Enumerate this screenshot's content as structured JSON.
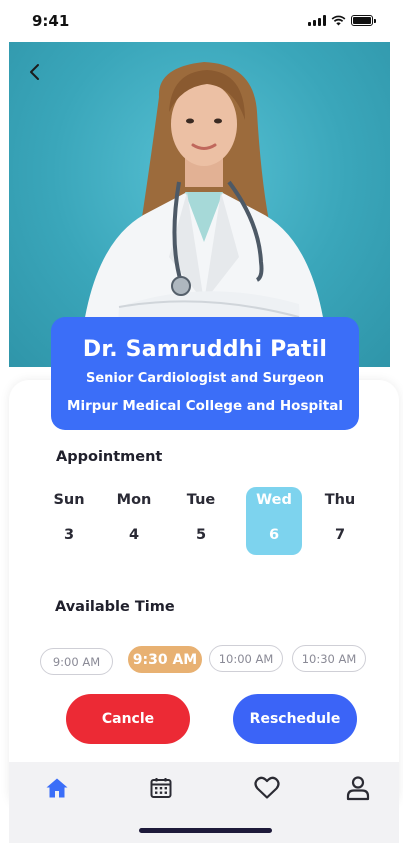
{
  "status_bar": {
    "time": "9:41"
  },
  "doctor": {
    "name": "Dr. Samruddhi Patil",
    "title": "Senior Cardiologist and Surgeon",
    "hospital": "Mirpur Medical College and Hospital"
  },
  "appointment": {
    "label": "Appointment",
    "days": [
      {
        "name": "Sun",
        "number": "3"
      },
      {
        "name": "Mon",
        "number": "4"
      },
      {
        "name": "Tue",
        "number": "5"
      },
      {
        "name": "Wed",
        "number": "6"
      },
      {
        "name": "Thu",
        "number": "7"
      }
    ],
    "selected_day_index": 3
  },
  "available_time": {
    "label": "Available Time",
    "slots": [
      "9:00 AM",
      "9:30 AM",
      "10:00 AM",
      "10:30 AM"
    ],
    "selected_slot_index": 1
  },
  "actions": {
    "cancel_label": "Cancle",
    "reschedule_label": "Reschedule"
  },
  "nav": {
    "items": [
      {
        "icon": "home-icon",
        "active": true
      },
      {
        "icon": "calendar-icon",
        "active": false
      },
      {
        "icon": "heart-icon",
        "active": false
      },
      {
        "icon": "user-icon",
        "active": false
      }
    ]
  },
  "colors": {
    "accent": "#3b6ef8",
    "selected_day": "#7dd3ee",
    "selected_slot": "#e8b172",
    "cancel": "#ec2a35",
    "reschedule": "#3b64f7"
  }
}
